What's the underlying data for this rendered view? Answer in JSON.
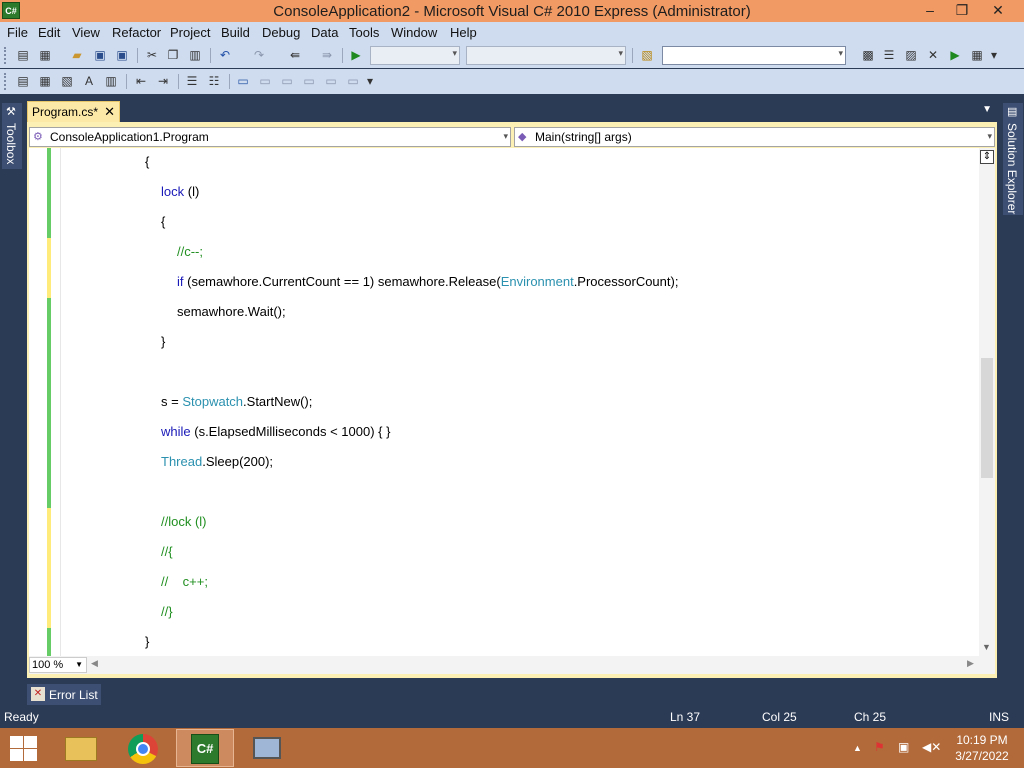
{
  "window": {
    "title": "ConsoleApplication2 - Microsoft Visual C# 2010 Express (Administrator)",
    "app_icon_text": "C#",
    "controls": {
      "minimize": "–",
      "restore": "❐",
      "close": "✕"
    }
  },
  "menu": [
    "File",
    "Edit",
    "View",
    "Refactor",
    "Project",
    "Build",
    "Debug",
    "Data",
    "Tools",
    "Window",
    "Help"
  ],
  "side_panels": {
    "left": "Toolbox",
    "right": "Solution Explorer"
  },
  "document_tab": {
    "label": "Program.cs*",
    "close": "✕"
  },
  "navigation": {
    "type_selector": "ConsoleApplication1.Program",
    "member_selector": "Main(string[] args)"
  },
  "code_lines": [
    {
      "indent": 0,
      "marker": "green",
      "parts": [
        {
          "t": "{",
          "c": ""
        }
      ]
    },
    {
      "indent": 1,
      "marker": "green",
      "parts": [
        {
          "t": "lock",
          "c": "kw"
        },
        {
          "t": " (l)",
          "c": ""
        }
      ]
    },
    {
      "indent": 1,
      "marker": "green",
      "parts": [
        {
          "t": "{",
          "c": ""
        }
      ]
    },
    {
      "indent": 2,
      "marker": "yellow",
      "parts": [
        {
          "t": "//c--;",
          "c": "cm"
        }
      ]
    },
    {
      "indent": 2,
      "marker": "yellow",
      "parts": [
        {
          "t": "if",
          "c": "kw"
        },
        {
          "t": " (semawhore.CurrentCount == 1) semawhore.Release(",
          "c": ""
        },
        {
          "t": "Environment",
          "c": "tp"
        },
        {
          "t": ".ProcessorCount);",
          "c": ""
        }
      ]
    },
    {
      "indent": 2,
      "marker": "green",
      "parts": [
        {
          "t": "semawhore.Wait();",
          "c": ""
        }
      ]
    },
    {
      "indent": 1,
      "marker": "green",
      "parts": [
        {
          "t": "}",
          "c": ""
        }
      ]
    },
    {
      "indent": 0,
      "marker": "green",
      "parts": []
    },
    {
      "indent": 1,
      "marker": "green",
      "parts": [
        {
          "t": "s = ",
          "c": ""
        },
        {
          "t": "Stopwatch",
          "c": "tp"
        },
        {
          "t": ".StartNew();",
          "c": ""
        }
      ]
    },
    {
      "indent": 1,
      "marker": "green",
      "parts": [
        {
          "t": "while",
          "c": "kw"
        },
        {
          "t": " (s.ElapsedMilliseconds < 1000) { }",
          "c": ""
        }
      ]
    },
    {
      "indent": 1,
      "marker": "green",
      "parts": [
        {
          "t": "Thread",
          "c": "tp"
        },
        {
          "t": ".Sleep(200);",
          "c": ""
        }
      ]
    },
    {
      "indent": 0,
      "marker": "green",
      "parts": []
    },
    {
      "indent": 1,
      "marker": "yellow",
      "parts": [
        {
          "t": "//lock (l)",
          "c": "cm"
        }
      ]
    },
    {
      "indent": 1,
      "marker": "yellow",
      "parts": [
        {
          "t": "//{",
          "c": "cm"
        }
      ]
    },
    {
      "indent": 1,
      "marker": "yellow",
      "parts": [
        {
          "t": "//    c++;",
          "c": "cm"
        }
      ]
    },
    {
      "indent": 1,
      "marker": "yellow",
      "parts": [
        {
          "t": "//}",
          "c": "cm"
        }
      ]
    },
    {
      "indent": 0,
      "marker": "green",
      "parts": [
        {
          "t": "}",
          "c": ""
        }
      ]
    }
  ],
  "zoom": "100 %",
  "bottom_tab": {
    "label": "Error List"
  },
  "status": {
    "ready": "Ready",
    "line": "Ln 37",
    "col": "Col 25",
    "ch": "Ch 25",
    "mode": "INS"
  },
  "clock": {
    "time": "10:19 PM",
    "date": "3/27/2022"
  },
  "colors": {
    "keyword": "#1a1ab8",
    "type": "#2b91af",
    "comment": "#218f21",
    "title_bar": "#f29a63",
    "taskbar": "#b26a3a"
  }
}
